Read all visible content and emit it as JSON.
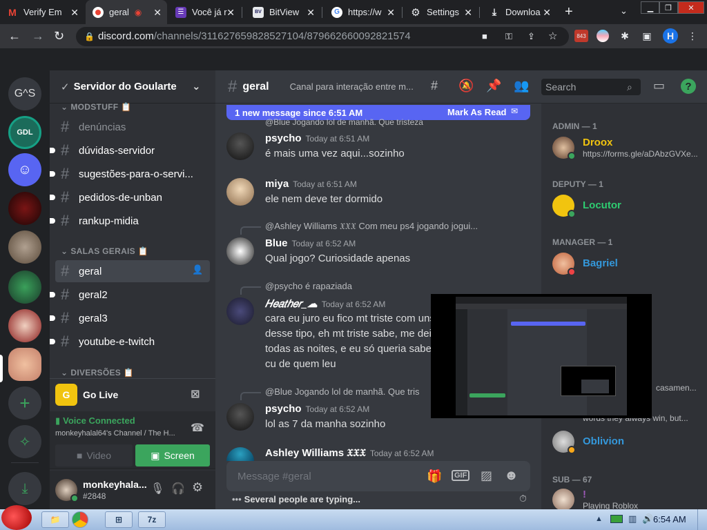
{
  "browser": {
    "tabs": [
      {
        "title": "Verify Em",
        "icon": "gmail-icon"
      },
      {
        "title": "geral",
        "icon": "discord-icon",
        "active": true
      },
      {
        "title": "Você já r",
        "icon": "forms-icon"
      },
      {
        "title": "BitView",
        "icon": "bitview-icon"
      },
      {
        "title": "https://w",
        "icon": "google-icon"
      },
      {
        "title": "Settings",
        "icon": "gear-icon"
      },
      {
        "title": "Downloa",
        "icon": "download-icon"
      }
    ],
    "url_host": "discord.com",
    "url_path": "/channels/311627659828527104/879662660092821574",
    "ext_badge": "843",
    "profile_letter": "H"
  },
  "guilds": [
    {
      "name": "G^S",
      "color": "#36393f"
    },
    {
      "name": "GDL",
      "color": "#1b6b5a"
    },
    {
      "name": "Discord",
      "color": "#5865f2"
    },
    {
      "name": "red server",
      "color": "#5a1010"
    },
    {
      "name": "cat server",
      "color": "#8a7a6a"
    },
    {
      "name": "green server",
      "color": "#2a6a3a"
    },
    {
      "name": "anime server",
      "color": "#8a1a1a"
    },
    {
      "name": "anime server 2",
      "color": "#c4806a"
    }
  ],
  "server": {
    "name": "Servidor do Goularte",
    "categories": {
      "modstuff": "MODSTUFF 📋",
      "salas": "SALAS GERAIS 📋",
      "diversoes": "DIVERSÕES 📋"
    },
    "channels_top": [
      {
        "name": "denúncias",
        "unread": false
      },
      {
        "name": "dúvidas-servidor",
        "unread": true
      },
      {
        "name": "sugestões-para-o-servi...",
        "unread": true
      },
      {
        "name": "pedidos-de-unban",
        "unread": true
      },
      {
        "name": "rankup-midia",
        "unread": true
      }
    ],
    "channels_salas": [
      {
        "name": "geral",
        "selected": true
      },
      {
        "name": "geral2",
        "unread": true
      },
      {
        "name": "geral3",
        "unread": true
      },
      {
        "name": "youtube-e-twitch",
        "unread": true
      }
    ]
  },
  "golive": {
    "label": "Go Live"
  },
  "voice": {
    "status": "Voice Connected",
    "channel": "monkeyhalal64's Channel / The H...",
    "video_label": "Video",
    "screen_label": "Screen"
  },
  "user": {
    "name": "monkeyhala...",
    "tag": "#2848"
  },
  "chat": {
    "channel": "geral",
    "topic": "Canal para interação entre m...",
    "search_placeholder": "Search",
    "new_banner": "1 new message since 6:51 AM",
    "mark_read": "Mark As Read",
    "top_reply": "@Blue Jogando lol de manhã. Que tristeza",
    "messages": [
      {
        "author": "psycho",
        "time": "Today at 6:51 AM",
        "text": "é mais uma vez aqui...sozinho",
        "color": "#ffffff"
      },
      {
        "author": "miya",
        "time": "Today at 6:51 AM",
        "text": "ele nem deve ter dormido",
        "color": "#ffffff"
      },
      {
        "author": "Blue",
        "time": "Today at 6:52 AM",
        "text": "Qual jogo? Curiosidade apenas",
        "reply": "@Ashley Williams 𝔛𝔛𝔛  Com meu ps4 jogando jogui...",
        "color": "#ffffff"
      },
      {
        "author": "𝐻𝑒𝑎𝑡ℎ𝑒𝑟_☁",
        "time": "Today at 6:52 AM",
        "lines": [
          "cara eu juro eu fico mt triste com uns",
          "desse tipo, eh mt triste sabe, me deix",
          "todas as noites, e eu só queria saber",
          "cu de quem leu"
        ],
        "reply": "@psycho é rapaziada",
        "color": "#ffffff"
      },
      {
        "author": "psycho",
        "time": "Today at 6:52 AM",
        "text": "lol as 7 da manha sozinho",
        "reply": "@Blue Jogando lol de manhã. Que tris",
        "color": "#ffffff"
      },
      {
        "author": "Ashley Williams 𝔛𝔛𝔛",
        "time": "Today at 6:52 AM",
        "text": "",
        "color": "#ffffff"
      }
    ],
    "composer_placeholder": "Message #geral",
    "typing": "Several people are typing..."
  },
  "members": {
    "groups": [
      {
        "role": "ADMIN — 1",
        "members": [
          {
            "name": "Droox",
            "sub": "https://forms.gle/aDAbzGVXe...",
            "color": "#f1c40f",
            "status": "#3ba55d"
          }
        ]
      },
      {
        "role": "DEPUTY — 1",
        "members": [
          {
            "name": "Locutor",
            "sub": "",
            "color": "#2ecc71",
            "status": "#3ba55d"
          }
        ]
      },
      {
        "role": "MANAGER — 1",
        "members": [
          {
            "name": "Bagriel",
            "sub": "",
            "color": "#3498db",
            "status": "#ed4245"
          }
        ]
      }
    ],
    "partial1": "casamen...",
    "partial2": "words they always win, but...",
    "oblivion": {
      "name": "Oblivion",
      "color": "#3498db"
    },
    "sub_role": "SUB — 67",
    "last": {
      "name": "!",
      "sub": "Playing Roblox",
      "color": "#9b59b6"
    }
  },
  "taskbar": {
    "clock": "6:54 AM",
    "zip_label": "7z"
  }
}
